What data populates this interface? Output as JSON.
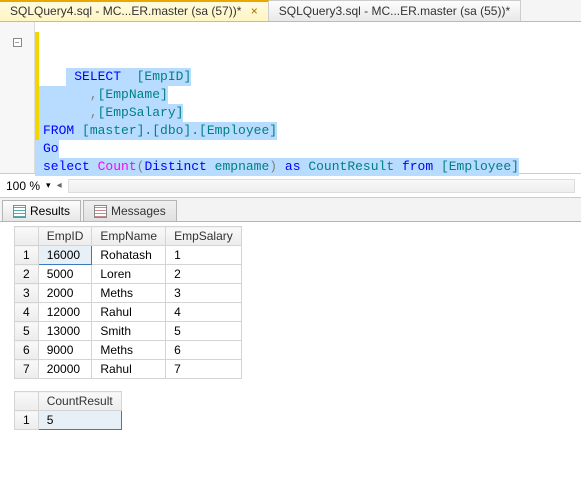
{
  "tabs": {
    "active": "SQLQuery4.sql - MC...ER.master (sa (57))*",
    "inactive": "SQLQuery3.sql - MC...ER.master (sa (55))*"
  },
  "editor": {
    "line1_kw": "SELECT",
    "line1_col": "  [EmpID]",
    "line2": "      ,",
    "line2_col": "[EmpName]",
    "line3": "      ,",
    "line3_col": "[EmpSalary]",
    "line4_from": "FROM",
    "line4_obj": " [master].[dbo].[Employee]",
    "line5": "Go",
    "line6_select": "select",
    "line6_count": " Count",
    "line6_paren1": "(",
    "line6_distinct": "Distinct",
    "line6_arg": " empname",
    "line6_paren2": ")",
    "line6_as": " as ",
    "line6_alias": "CountResult",
    "line6_from": " from ",
    "line6_tbl": "[Employee]"
  },
  "zoom": {
    "value": "100 %"
  },
  "result_tabs": {
    "results": "Results",
    "messages": "Messages"
  },
  "grid1": {
    "headers": [
      "EmpID",
      "EmpName",
      "EmpSalary"
    ],
    "rows": [
      {
        "n": "1",
        "c": [
          "16000",
          "Rohatash",
          "1"
        ]
      },
      {
        "n": "2",
        "c": [
          "5000",
          "Loren",
          "2"
        ]
      },
      {
        "n": "3",
        "c": [
          "2000",
          "Meths",
          "3"
        ]
      },
      {
        "n": "4",
        "c": [
          "12000",
          "Rahul",
          "4"
        ]
      },
      {
        "n": "5",
        "c": [
          "13000",
          "Smith",
          "5"
        ]
      },
      {
        "n": "6",
        "c": [
          "9000",
          "Meths",
          "6"
        ]
      },
      {
        "n": "7",
        "c": [
          "20000",
          "Rahul",
          "7"
        ]
      }
    ]
  },
  "grid2": {
    "header": "CountResult",
    "row_n": "1",
    "value": "5"
  }
}
